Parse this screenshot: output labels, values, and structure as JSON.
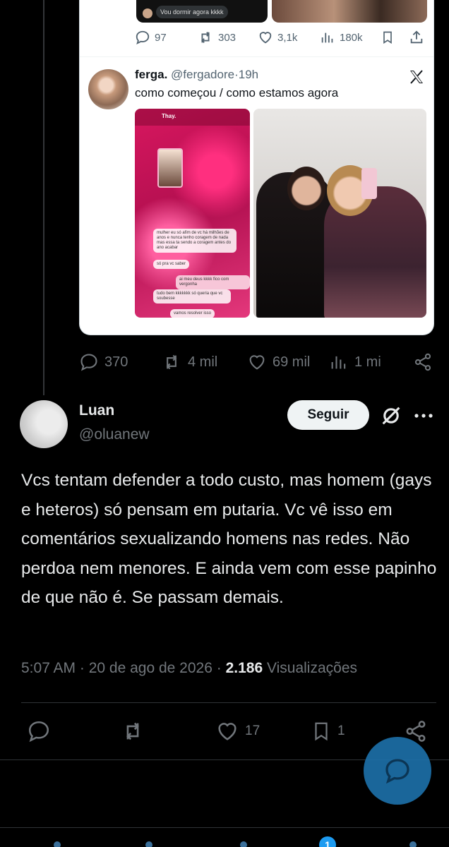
{
  "preview_tweet": {
    "message_bubble": "Vou dormir agora kkkk",
    "actions": {
      "replies": "97",
      "reposts": "303",
      "likes": "3,1k",
      "views": "180k"
    }
  },
  "quoted_tweet": {
    "name": "ferga.",
    "handle": "@fergadore",
    "time": "19h",
    "text": "como começou / como estamos agora",
    "screenshot": {
      "chat_name": "Thay.",
      "bubble_1": "mulher eu só afim de vc há milhões de anos e nunca tenho coragem de nada mas essa ta sendo a coragem antes do ano acabar",
      "bubble_2": "só pra vc saber",
      "bubble_3": "ai meu deus kkkk fico com vergonha",
      "bubble_4": "tudo bem kkkkkkk só queria que vc soubesse",
      "bubble_5": "vamos resolver isso"
    }
  },
  "outer_actions": {
    "replies": "370",
    "reposts": "4 mil",
    "likes": "69 mil",
    "views": "1 mi"
  },
  "reply": {
    "name": "Luan",
    "handle": "@oluanew",
    "follow_label": "Seguir",
    "text": "Vcs tentam defender a todo custo, mas homem (gays e heteros) só pensam em putaria. Vc vê isso em comentários sexualizando homens nas redes. Não perdoa nem menores. E ainda vem com esse papinho de que não é. Se passam demais.",
    "time": "5:07 AM",
    "date": "20 de ago de 2026",
    "views_count": "2.186",
    "views_label": "Visualizações",
    "actions": {
      "likes": "17",
      "bookmarks": "1"
    }
  },
  "nav": {
    "badge": "1"
  },
  "colors": {
    "background": "#000000",
    "text": "#e7e9ea",
    "secondary": "#71767b",
    "accent": "#1d9bf0"
  }
}
